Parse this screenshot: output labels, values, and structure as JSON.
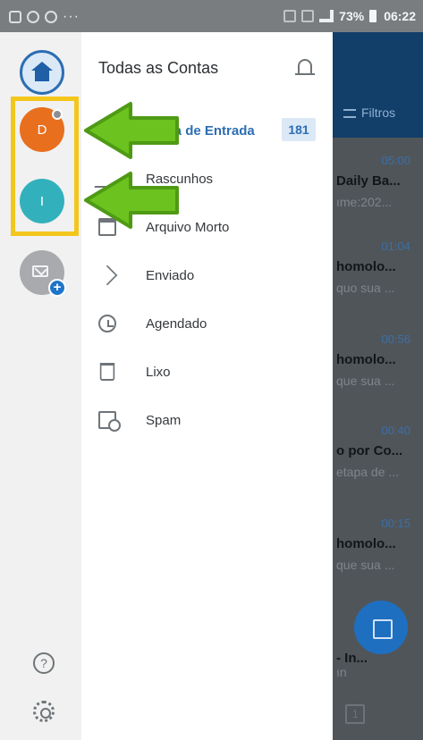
{
  "status_bar": {
    "battery": "73%",
    "time": "06:22"
  },
  "rail": {
    "accounts": [
      {
        "initial": "D",
        "color": "#e86f1d"
      },
      {
        "initial": "I",
        "color": "#32b1bd"
      }
    ],
    "highlight_color": "#f3c61b"
  },
  "panel": {
    "title": "Todas as Contas",
    "folders": [
      {
        "label": "Caixa de Entrada",
        "count": "181",
        "icon": "inbox-icon",
        "selected": true
      },
      {
        "label": "Rascunhos",
        "icon": "drafts-icon"
      },
      {
        "label": "Arquivo Morto",
        "icon": "archive-icon"
      },
      {
        "label": "Enviado",
        "icon": "sent-icon"
      },
      {
        "label": "Agendado",
        "icon": "scheduled-icon"
      },
      {
        "label": "Lixo",
        "icon": "trash-icon"
      },
      {
        "label": "Spam",
        "icon": "spam-icon"
      }
    ]
  },
  "background": {
    "filters_label": "Filtros",
    "emails": [
      {
        "time": "05:00",
        "subject": "Daily Ba...",
        "preview": "ıme:202..."
      },
      {
        "time": "01:04",
        "subject": "homolo...",
        "preview": "quo sua ..."
      },
      {
        "time": "00:56",
        "subject": "homolo...",
        "preview": "que sua ..."
      },
      {
        "time": "00:40",
        "subject": "o por Co...",
        "preview": "etapa de ..."
      },
      {
        "time": "00:15",
        "subject": "homolo...",
        "preview": "que sua ..."
      },
      {
        "time": "",
        "subject": "- In...",
        "preview": "ın"
      }
    ],
    "calendar_day": "1"
  },
  "colors": {
    "accent": "#2c6eb3",
    "arrow": "#6cc21e",
    "arrow_outline": "#4e9a15"
  }
}
